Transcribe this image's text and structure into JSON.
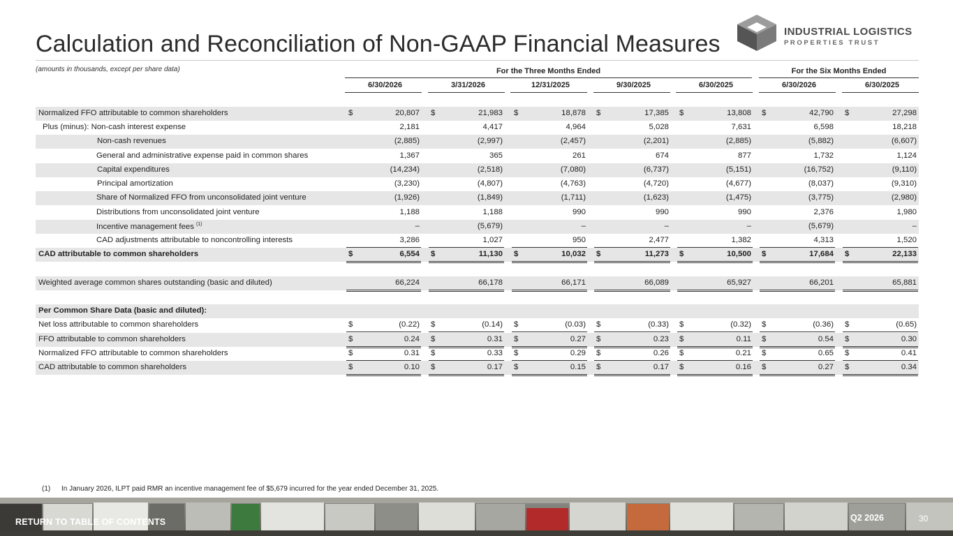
{
  "header": {
    "title": "Calculation and Reconciliation of Non-GAAP Financial Measures",
    "logo_line1": "INDUSTRIAL LOGISTICS",
    "logo_line2": "PROPERTIES TRUST",
    "amounts_note": "(amounts in thousands, except per share data)"
  },
  "table": {
    "group_three_months": "For the Three Months Ended",
    "group_six_months": "For the Six Months Ended",
    "columns": [
      "6/30/2026",
      "3/31/2026",
      "12/31/2025",
      "9/30/2025",
      "6/30/2025",
      "6/30/2026",
      "6/30/2025"
    ],
    "rows": [
      {
        "label": "Normalized FFO attributable to common shareholders",
        "dollar": "$",
        "values": [
          "20,807",
          "21,983",
          "18,878",
          "17,385",
          "13,808",
          "42,790",
          "27,298"
        ]
      },
      {
        "label": "Plus (minus): Non-cash interest expense",
        "dollar": "",
        "values": [
          "2,181",
          "4,417",
          "4,964",
          "5,028",
          "7,631",
          "6,598",
          "18,218"
        ]
      },
      {
        "label": "Non-cash revenues",
        "dollar": "",
        "values": [
          "(2,885)",
          "(2,997)",
          "(2,457)",
          "(2,201)",
          "(2,885)",
          "(5,882)",
          "(6,607)"
        ]
      },
      {
        "label": "General and administrative expense paid in common shares",
        "dollar": "",
        "values": [
          "1,367",
          "365",
          "261",
          "674",
          "877",
          "1,732",
          "1,124"
        ]
      },
      {
        "label": "Capital expenditures",
        "dollar": "",
        "values": [
          "(14,234)",
          "(2,518)",
          "(7,080)",
          "(6,737)",
          "(5,151)",
          "(16,752)",
          "(9,110)"
        ]
      },
      {
        "label": "Principal amortization",
        "dollar": "",
        "values": [
          "(3,230)",
          "(4,807)",
          "(4,763)",
          "(4,720)",
          "(4,677)",
          "(8,037)",
          "(9,310)"
        ]
      },
      {
        "label": "Share of Normalized FFO from unconsolidated joint venture",
        "dollar": "",
        "values": [
          "(1,926)",
          "(1,849)",
          "(1,711)",
          "(1,623)",
          "(1,475)",
          "(3,775)",
          "(2,980)"
        ]
      },
      {
        "label": "Distributions from unconsolidated joint venture",
        "dollar": "",
        "values": [
          "1,188",
          "1,188",
          "990",
          "990",
          "990",
          "2,376",
          "1,980"
        ]
      },
      {
        "label": "Incentive management fees",
        "sup": "(1)",
        "dollar": "",
        "values": [
          "–",
          "(5,679)",
          "–",
          "–",
          "–",
          "(5,679)",
          "–"
        ]
      },
      {
        "label": "CAD adjustments attributable to noncontrolling interests",
        "dollar": "",
        "values": [
          "3,286",
          "1,027",
          "950",
          "2,477",
          "1,382",
          "4,313",
          "1,520"
        ]
      },
      {
        "label": "CAD attributable to common shareholders",
        "dollar": "$",
        "values": [
          "6,554",
          "11,130",
          "10,032",
          "11,273",
          "10,500",
          "17,684",
          "22,133"
        ]
      },
      {
        "label": "Weighted average common shares outstanding (basic and diluted)",
        "dollar": "",
        "values": [
          "66,224",
          "66,178",
          "66,171",
          "66,089",
          "65,927",
          "66,201",
          "65,881"
        ]
      },
      {
        "label": "Per Common Share Data (basic and diluted):",
        "dollar": "",
        "values": []
      },
      {
        "label": "Net loss attributable to common shareholders",
        "dollar": "$",
        "values": [
          "(0.22)",
          "(0.14)",
          "(0.03)",
          "(0.33)",
          "(0.32)",
          "(0.36)",
          "(0.65)"
        ]
      },
      {
        "label": "FFO attributable to common shareholders",
        "dollar": "$",
        "values": [
          "0.24",
          "0.31",
          "0.27",
          "0.23",
          "0.11",
          "0.54",
          "0.30"
        ]
      },
      {
        "label": "Normalized FFO attributable to common shareholders",
        "dollar": "$",
        "values": [
          "0.31",
          "0.33",
          "0.29",
          "0.26",
          "0.21",
          "0.65",
          "0.41"
        ]
      },
      {
        "label": "CAD attributable to common shareholders",
        "dollar": "$",
        "values": [
          "0.10",
          "0.17",
          "0.15",
          "0.17",
          "0.16",
          "0.27",
          "0.34"
        ]
      }
    ]
  },
  "footnote": {
    "number": "(1)",
    "text": "In January 2026, ILPT paid RMR an incentive management fee of $5,679 incurred for the year ended December 31, 2025."
  },
  "footer": {
    "toc_link": "RETURN TO TABLE OF CONTENTS",
    "quarter": "Q2 2026",
    "page_number": "30"
  },
  "colors": {
    "row_shade": "#e6e6e6",
    "title_text": "#2b2b2b",
    "logo_gray": "#4a4a4a"
  }
}
